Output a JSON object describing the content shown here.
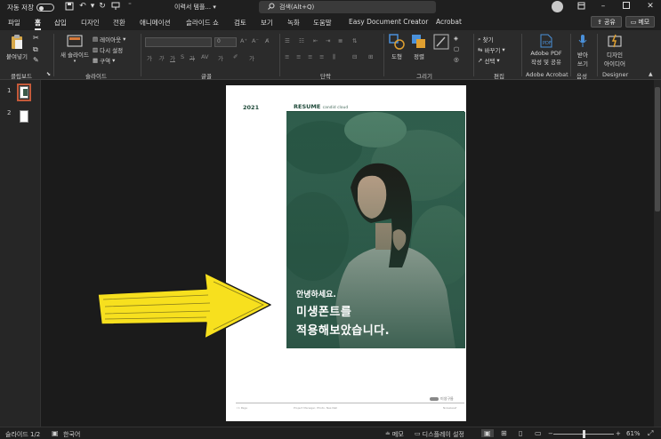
{
  "titlebar": {
    "autosave_label": "자동 저장",
    "autosave_state": "끔",
    "filename": "이력서 템플...",
    "filename_caret": "▾",
    "search_placeholder": "검색(Alt+Q)"
  },
  "tabs": [
    {
      "label": "파일"
    },
    {
      "label": "홈"
    },
    {
      "label": "삽입"
    },
    {
      "label": "디자인"
    },
    {
      "label": "전환"
    },
    {
      "label": "애니메이션"
    },
    {
      "label": "슬라이드 쇼"
    },
    {
      "label": "검토"
    },
    {
      "label": "보기"
    },
    {
      "label": "녹화"
    },
    {
      "label": "도움말"
    },
    {
      "label": "Easy Document Creator"
    },
    {
      "label": "Acrobat"
    }
  ],
  "share_label": "공유",
  "memo_label": "메모",
  "ribbon": {
    "paste_label": "붙여넣기",
    "new_slide_label": "새 슬라이드",
    "layout_label": "레이아웃",
    "reset_label": "다시 설정",
    "section_label": "구역",
    "font_size_placeholder": "0",
    "shape_label": "도형",
    "arrange_label": "정렬",
    "find_label": "찾기",
    "replace_label": "바꾸기",
    "select_label": "선택",
    "adobe_pdf_label": "Adobe PDF",
    "adobe_pdf_label2": "작성 및 공유",
    "dictate_label": "받아",
    "dictate_label2": "쓰기",
    "designer_label": "디자인",
    "designer_label2": "아이디어",
    "groups": {
      "clipboard": "클립보드",
      "slides": "슬라이드",
      "font": "글꼴",
      "paragraph": "단락",
      "drawing": "그리기",
      "editing": "편집",
      "acrobat": "Adobe Acrobat",
      "voice": "음성",
      "designer": "Designer"
    }
  },
  "thumbnails": [
    {
      "number": "1"
    },
    {
      "number": "2"
    }
  ],
  "slide": {
    "year": "2021",
    "resume_title": "RESUME",
    "resume_subtitle": "candid cloud",
    "greeting": "안녕하세요.",
    "line2": "미생폰트를",
    "line3": "적용해보았습니다.",
    "logo_text": "미생구름",
    "footer_left": "I 1 Page",
    "footer_mid": "Project Manager, Photo, Nas Nell",
    "footer_right": "Noiselessf"
  },
  "status": {
    "slide_indicator": "슬라이드 1/2",
    "language": "한국어",
    "notes_label": "메모",
    "display_settings_label": "디스플레이 설정",
    "zoom": "61%",
    "zoom_minus": "−",
    "zoom_plus": "+"
  },
  "colors": {
    "accent_green": "#1f4a3a",
    "arrow_yellow": "#f7e01e",
    "selection_red": "#c55a3a"
  }
}
